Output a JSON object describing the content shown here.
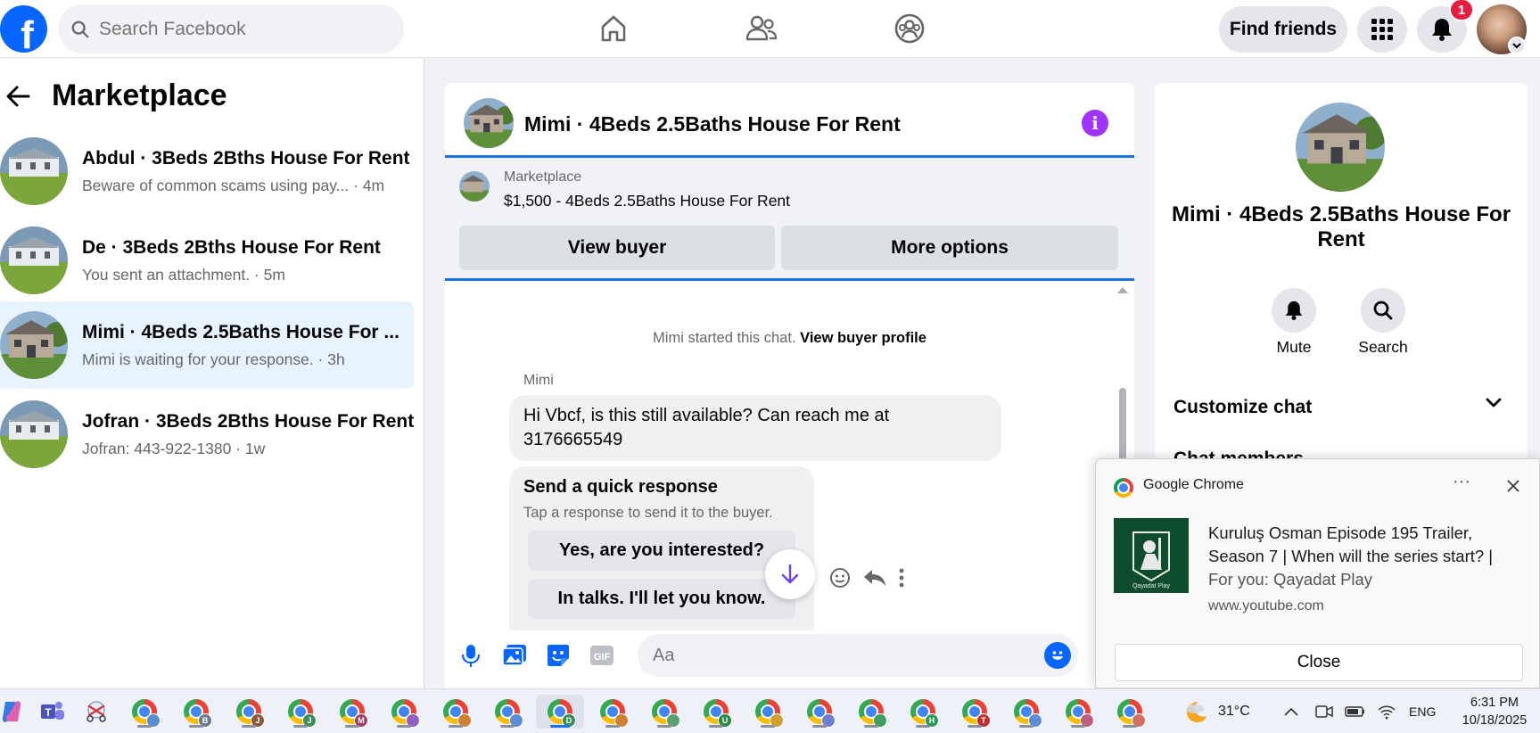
{
  "topbar": {
    "logo": "f",
    "search_placeholder": "Search Facebook",
    "find_friends": "Find friends",
    "notification_count": "1",
    "nav_icons": [
      "home-icon",
      "friends-icon",
      "groups-icon"
    ]
  },
  "marketplace": {
    "title": "Marketplace",
    "conversations": [
      {
        "name": "Abdul · 3Beds 2Bths House For Rent",
        "preview": "Beware of common scams using pay...",
        "time": " · 4m"
      },
      {
        "name": "De · 3Beds 2Bths House For Rent",
        "preview": "You sent an attachment.",
        "time": " · 5m"
      },
      {
        "name": "Mimi · 4Beds 2.5Baths House For ...",
        "preview": "Mimi is waiting for your response.",
        "time": " · 3h"
      },
      {
        "name": "Jofran · 3Beds 2Bths House For Rent",
        "preview": "Jofran: 443-922-1380",
        "time": " · 1w"
      }
    ]
  },
  "chat": {
    "title": "Mimi · 4Beds 2.5Baths House For Rent",
    "banner_label": "Marketplace",
    "banner_listing": "$1,500 - 4Beds 2.5Baths House For Rent",
    "view_buyer": "View buyer",
    "more_options": "More options",
    "started_text": "Mimi started this chat.",
    "view_buyer_profile": "View buyer profile",
    "sender": "Mimi",
    "message": "Hi Vbcf, is this still available? Can reach me at 3176665549",
    "quick_title": "Send a quick response",
    "quick_sub": "Tap a response to send it to the buyer.",
    "quick_replies": [
      "Yes, are you interested?",
      "In talks. I'll let you know."
    ],
    "input_placeholder": "Aa",
    "gif_label": "GIF"
  },
  "info_panel": {
    "title": "Mimi · 4Beds 2.5Baths House For Rent",
    "mute": "Mute",
    "search": "Search",
    "customize": "Customize chat",
    "chat_members": "Chat members"
  },
  "notification": {
    "app": "Google Chrome",
    "more": "···",
    "title": "Kuruluş Osman Episode 195 Trailer, Season 7 | When will the series start? |",
    "subtitle": "For you: Qayadat Play",
    "url": "www.youtube.com",
    "close": "Close",
    "image_caption": "Qayadat Play"
  },
  "taskbar": {
    "profiles": [
      "",
      "B",
      "J",
      "J",
      "M",
      "",
      "",
      "",
      "D",
      "",
      "",
      "U",
      "",
      "",
      "",
      "H",
      "T",
      "",
      "",
      ""
    ],
    "profile_colors": [
      "#5b8dd6",
      "#6a7a8a",
      "#8b5a3c",
      "#3c8b5a",
      "#a04060",
      "#9060c0",
      "#d08030",
      "#5b8dd6",
      "#3c8b5a",
      "#d08030",
      "#5aa070",
      "#2a8a4a",
      "#d0a030",
      "#7080d0",
      "#3ca060",
      "#2a9a5a",
      "#c03030",
      "#5b8dd6",
      "#c06080",
      "#d07060"
    ],
    "weather": "31°C",
    "lang": "ENG",
    "time": "6:31 PM",
    "date": "10/18/2025"
  }
}
